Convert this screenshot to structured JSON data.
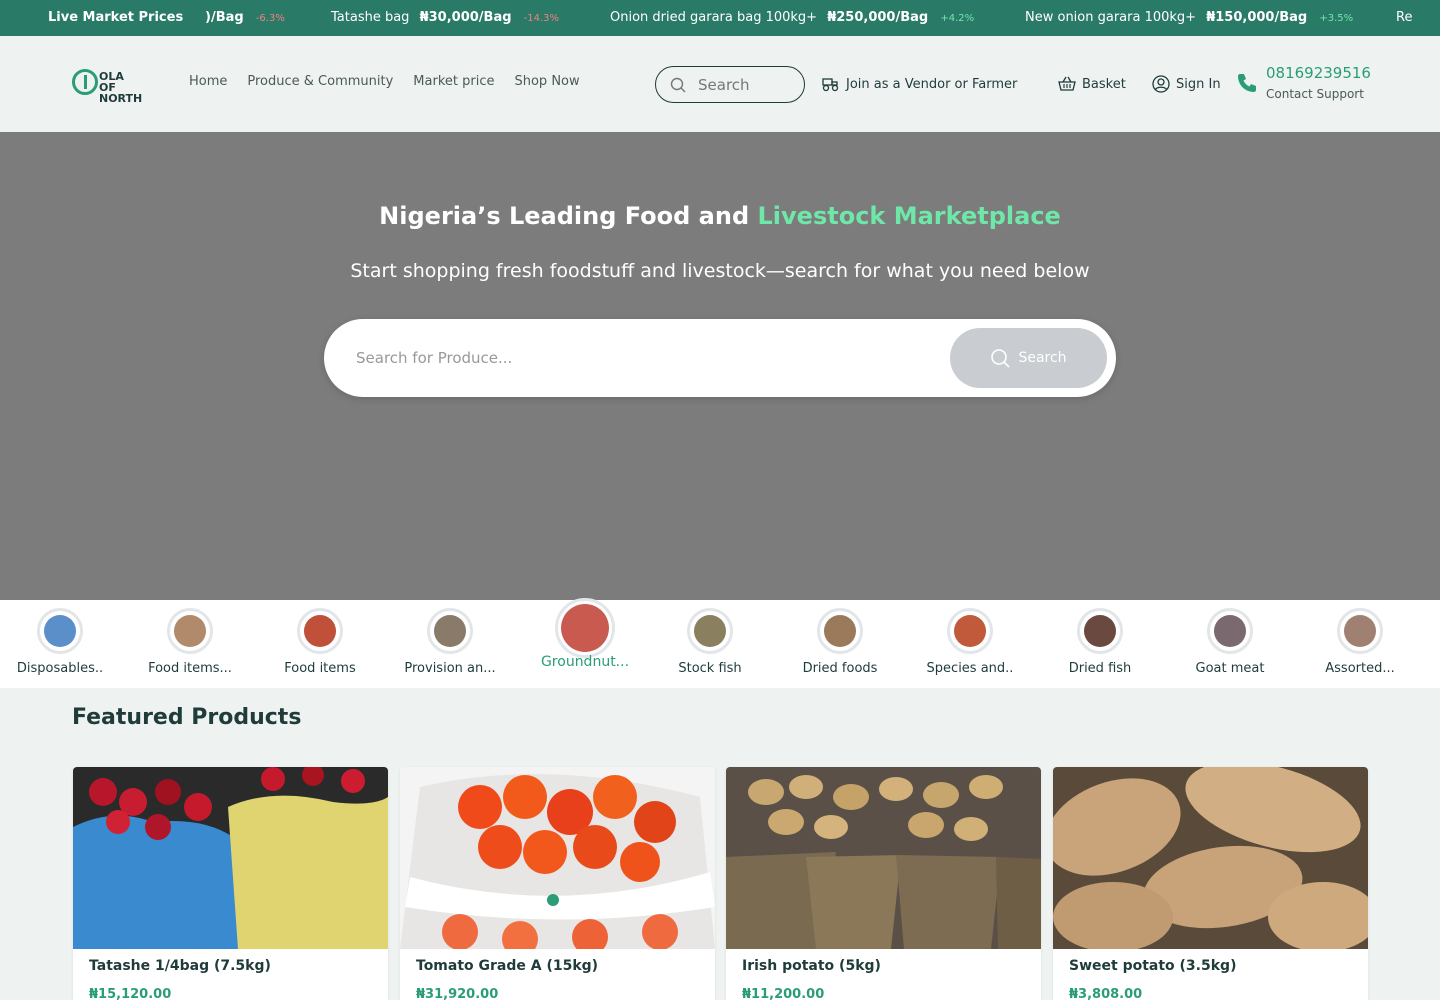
{
  "ticker": {
    "title": "Live Market Prices",
    "items": [
      {
        "name": "",
        "price": ")/Bag",
        "change": "-6.3%",
        "direction": "down"
      },
      {
        "name": "Tatashe bag",
        "price": "₦30,000/Bag",
        "change": "-14.3%",
        "direction": "down"
      },
      {
        "name": "Onion dried garara bag 100kg+",
        "price": "₦250,000/Bag",
        "change": "+4.2%",
        "direction": "up"
      },
      {
        "name": "New onion garara 100kg+",
        "price": "₦150,000/Bag",
        "change": "+3.5%",
        "direction": "up"
      },
      {
        "name": "Re",
        "price": "",
        "change": "",
        "direction": ""
      }
    ]
  },
  "header": {
    "logo_text_1": "OLA OF",
    "logo_text_2": "NORTH",
    "nav": [
      "Home",
      "Produce & Community",
      "Market price",
      "Shop Now"
    ],
    "search_placeholder": "Search",
    "join_label": "Join as a Vendor or Farmer",
    "basket_label": "Basket",
    "signin_label": "Sign In",
    "phone": "08169239516",
    "support_label": "Contact Support"
  },
  "hero": {
    "title_main": "Nigeria’s Leading Food and ",
    "title_highlight": "Livestock Marketplace",
    "subtitle": "Start shopping fresh foodstuff and livestock—search for what you need below",
    "search_placeholder": "Search for Produce...",
    "search_button": "Search"
  },
  "categories": [
    {
      "label": "Disposables..",
      "color": "#5b8fc9"
    },
    {
      "label": "Food items...",
      "color": "#b08a6a"
    },
    {
      "label": "Food items",
      "color": "#c0503a"
    },
    {
      "label": "Provision an...",
      "color": "#8a7a6a"
    },
    {
      "label": "Groundnut...",
      "color": "#c85a50"
    },
    {
      "label": "Stock fish",
      "color": "#8a8060"
    },
    {
      "label": "Dried foods",
      "color": "#9a7a5a"
    },
    {
      "label": "Species and..",
      "color": "#c05a3a"
    },
    {
      "label": "Dried fish",
      "color": "#6a4a40"
    },
    {
      "label": "Goat meat",
      "color": "#7a6a70"
    },
    {
      "label": "Assorted...",
      "color": "#a08070"
    }
  ],
  "featured": {
    "title": "Featured Products",
    "products": [
      {
        "name": "Tatashe 1/4bag (7.5kg)",
        "price": "₦15,120.00"
      },
      {
        "name": "Tomato Grade A (15kg)",
        "price": "₦31,920.00"
      },
      {
        "name": "Irish potato (5kg)",
        "price": "₦11,200.00"
      },
      {
        "name": "Sweet potato (3.5kg)",
        "price": "₦3,808.00"
      }
    ]
  },
  "colors": {
    "brand": "#2a9d77",
    "ticker_bg": "#2a7a68",
    "hero_bg": "#7c7c7c",
    "highlight": "#6ee7a8"
  }
}
